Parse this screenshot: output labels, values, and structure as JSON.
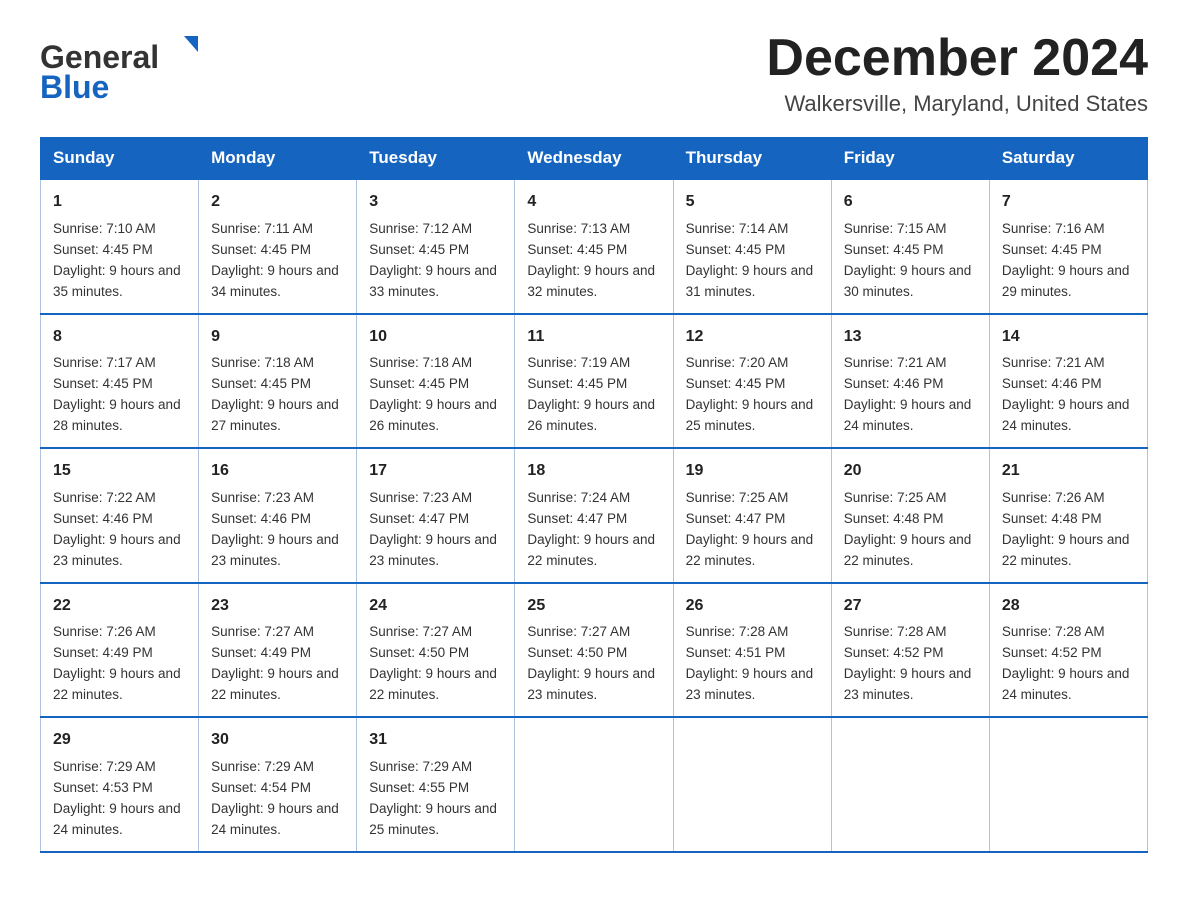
{
  "header": {
    "logo_general": "General",
    "logo_blue": "Blue",
    "month_title": "December 2024",
    "location": "Walkersville, Maryland, United States"
  },
  "days_of_week": [
    "Sunday",
    "Monday",
    "Tuesday",
    "Wednesday",
    "Thursday",
    "Friday",
    "Saturday"
  ],
  "weeks": [
    [
      {
        "day": "1",
        "sunrise": "7:10 AM",
        "sunset": "4:45 PM",
        "daylight": "9 hours and 35 minutes."
      },
      {
        "day": "2",
        "sunrise": "7:11 AM",
        "sunset": "4:45 PM",
        "daylight": "9 hours and 34 minutes."
      },
      {
        "day": "3",
        "sunrise": "7:12 AM",
        "sunset": "4:45 PM",
        "daylight": "9 hours and 33 minutes."
      },
      {
        "day": "4",
        "sunrise": "7:13 AM",
        "sunset": "4:45 PM",
        "daylight": "9 hours and 32 minutes."
      },
      {
        "day": "5",
        "sunrise": "7:14 AM",
        "sunset": "4:45 PM",
        "daylight": "9 hours and 31 minutes."
      },
      {
        "day": "6",
        "sunrise": "7:15 AM",
        "sunset": "4:45 PM",
        "daylight": "9 hours and 30 minutes."
      },
      {
        "day": "7",
        "sunrise": "7:16 AM",
        "sunset": "4:45 PM",
        "daylight": "9 hours and 29 minutes."
      }
    ],
    [
      {
        "day": "8",
        "sunrise": "7:17 AM",
        "sunset": "4:45 PM",
        "daylight": "9 hours and 28 minutes."
      },
      {
        "day": "9",
        "sunrise": "7:18 AM",
        "sunset": "4:45 PM",
        "daylight": "9 hours and 27 minutes."
      },
      {
        "day": "10",
        "sunrise": "7:18 AM",
        "sunset": "4:45 PM",
        "daylight": "9 hours and 26 minutes."
      },
      {
        "day": "11",
        "sunrise": "7:19 AM",
        "sunset": "4:45 PM",
        "daylight": "9 hours and 26 minutes."
      },
      {
        "day": "12",
        "sunrise": "7:20 AM",
        "sunset": "4:45 PM",
        "daylight": "9 hours and 25 minutes."
      },
      {
        "day": "13",
        "sunrise": "7:21 AM",
        "sunset": "4:46 PM",
        "daylight": "9 hours and 24 minutes."
      },
      {
        "day": "14",
        "sunrise": "7:21 AM",
        "sunset": "4:46 PM",
        "daylight": "9 hours and 24 minutes."
      }
    ],
    [
      {
        "day": "15",
        "sunrise": "7:22 AM",
        "sunset": "4:46 PM",
        "daylight": "9 hours and 23 minutes."
      },
      {
        "day": "16",
        "sunrise": "7:23 AM",
        "sunset": "4:46 PM",
        "daylight": "9 hours and 23 minutes."
      },
      {
        "day": "17",
        "sunrise": "7:23 AM",
        "sunset": "4:47 PM",
        "daylight": "9 hours and 23 minutes."
      },
      {
        "day": "18",
        "sunrise": "7:24 AM",
        "sunset": "4:47 PM",
        "daylight": "9 hours and 22 minutes."
      },
      {
        "day": "19",
        "sunrise": "7:25 AM",
        "sunset": "4:47 PM",
        "daylight": "9 hours and 22 minutes."
      },
      {
        "day": "20",
        "sunrise": "7:25 AM",
        "sunset": "4:48 PM",
        "daylight": "9 hours and 22 minutes."
      },
      {
        "day": "21",
        "sunrise": "7:26 AM",
        "sunset": "4:48 PM",
        "daylight": "9 hours and 22 minutes."
      }
    ],
    [
      {
        "day": "22",
        "sunrise": "7:26 AM",
        "sunset": "4:49 PM",
        "daylight": "9 hours and 22 minutes."
      },
      {
        "day": "23",
        "sunrise": "7:27 AM",
        "sunset": "4:49 PM",
        "daylight": "9 hours and 22 minutes."
      },
      {
        "day": "24",
        "sunrise": "7:27 AM",
        "sunset": "4:50 PM",
        "daylight": "9 hours and 22 minutes."
      },
      {
        "day": "25",
        "sunrise": "7:27 AM",
        "sunset": "4:50 PM",
        "daylight": "9 hours and 23 minutes."
      },
      {
        "day": "26",
        "sunrise": "7:28 AM",
        "sunset": "4:51 PM",
        "daylight": "9 hours and 23 minutes."
      },
      {
        "day": "27",
        "sunrise": "7:28 AM",
        "sunset": "4:52 PM",
        "daylight": "9 hours and 23 minutes."
      },
      {
        "day": "28",
        "sunrise": "7:28 AM",
        "sunset": "4:52 PM",
        "daylight": "9 hours and 24 minutes."
      }
    ],
    [
      {
        "day": "29",
        "sunrise": "7:29 AM",
        "sunset": "4:53 PM",
        "daylight": "9 hours and 24 minutes."
      },
      {
        "day": "30",
        "sunrise": "7:29 AM",
        "sunset": "4:54 PM",
        "daylight": "9 hours and 24 minutes."
      },
      {
        "day": "31",
        "sunrise": "7:29 AM",
        "sunset": "4:55 PM",
        "daylight": "9 hours and 25 minutes."
      },
      null,
      null,
      null,
      null
    ]
  ],
  "labels": {
    "sunrise": "Sunrise:",
    "sunset": "Sunset:",
    "daylight": "Daylight:"
  }
}
